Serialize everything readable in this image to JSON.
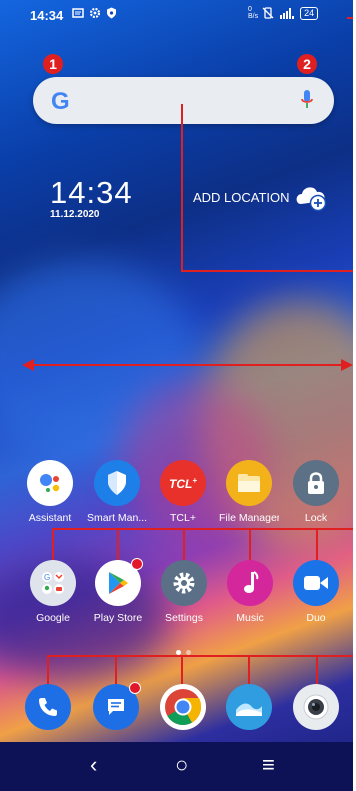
{
  "status_bar": {
    "time": "14:34",
    "battery": "24"
  },
  "markers": [
    "1",
    "2"
  ],
  "search": {
    "google_logo": "G",
    "mic_icon": "mic-icon"
  },
  "clock": {
    "time": "14:34",
    "date": "11.12.2020"
  },
  "weather": {
    "label": "ADD LOCATION"
  },
  "apps_row1": [
    {
      "label": "Assistant",
      "icon": "assistant-icon"
    },
    {
      "label": "Smart Man...",
      "icon": "shield-icon"
    },
    {
      "label": "TCL+",
      "icon": "tcl-plus-icon"
    },
    {
      "label": "File Manager",
      "icon": "folder-icon"
    },
    {
      "label": "Lock",
      "icon": "lock-icon"
    }
  ],
  "apps_row2": [
    {
      "label": "Google",
      "icon": "google-folder-icon"
    },
    {
      "label": "Play Store",
      "icon": "play-store-icon"
    },
    {
      "label": "Settings",
      "icon": "settings-gear-icon"
    },
    {
      "label": "Music",
      "icon": "music-note-icon"
    },
    {
      "label": "Duo",
      "icon": "video-camera-icon"
    }
  ],
  "dock": [
    {
      "icon": "phone-icon"
    },
    {
      "icon": "messages-icon"
    },
    {
      "icon": "chrome-icon"
    },
    {
      "icon": "gallery-icon"
    },
    {
      "icon": "camera-icon"
    }
  ],
  "nav": {
    "back": "‹",
    "home": "○",
    "recents": "≡"
  },
  "colors": {
    "annotation_red": "#e02020",
    "notification_dot": "#e3172a"
  }
}
